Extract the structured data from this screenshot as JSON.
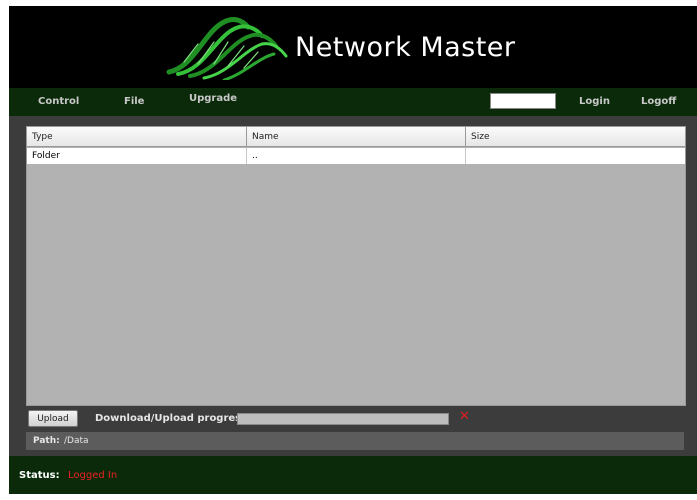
{
  "app": {
    "title": "Network Master"
  },
  "nav": {
    "control": "Control",
    "file": "File",
    "upgrade": "Upgrade",
    "search_value": "",
    "login": "Login",
    "logoff": "Logoff"
  },
  "table": {
    "columns": [
      "Type",
      "Name",
      "Size"
    ],
    "rows": [
      {
        "type": "Folder",
        "name": "..",
        "size": ""
      }
    ]
  },
  "upload": {
    "button_label": "Upload",
    "progress_label": "Download/Upload progress:",
    "progress": 0,
    "cancel_icon": "close-icon",
    "cancel_color": "#e02020"
  },
  "path": {
    "label": "Path:",
    "value": "/Data"
  },
  "status": {
    "label": "Status:",
    "value": "Logged In",
    "value_color": "#ee2020"
  },
  "colors": {
    "accent": "#2fae33",
    "nav_bg": "#0a2a0a",
    "background": "#000000"
  }
}
